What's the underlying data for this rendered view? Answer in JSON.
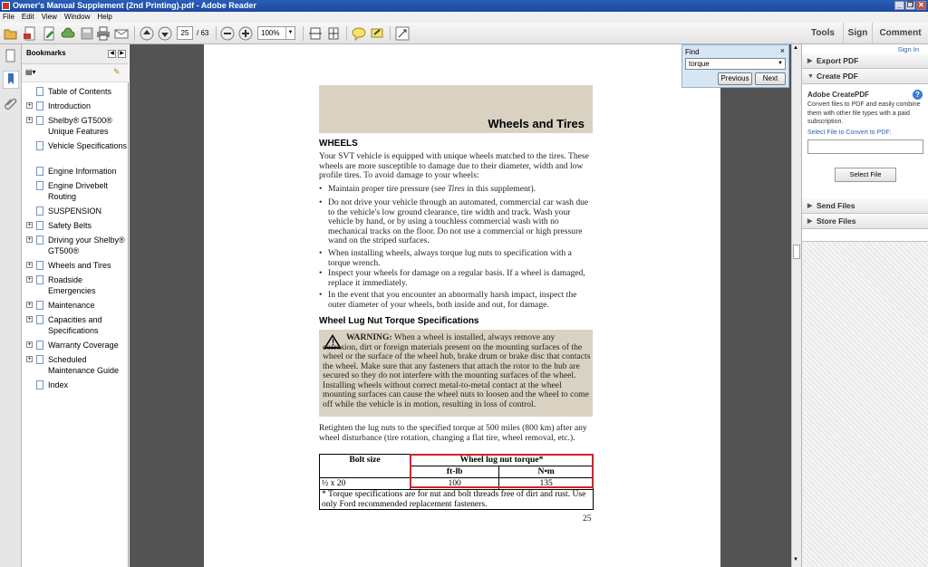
{
  "window": {
    "title": "Owner's Manual Supplement (2nd Printing).pdf - Adobe Reader"
  },
  "menu": [
    "File",
    "Edit",
    "View",
    "Window",
    "Help"
  ],
  "toolbar": {
    "page_current": "25",
    "page_total": "/ 63",
    "zoom": "100%",
    "tools": "Tools",
    "sign": "Sign",
    "comment": "Comment"
  },
  "bookmarks": {
    "title": "Bookmarks",
    "items": [
      {
        "label": "Table of Contents",
        "expandable": false
      },
      {
        "label": "Introduction",
        "expandable": true
      },
      {
        "label": "Shelby® GT500® Unique Features",
        "expandable": true
      },
      {
        "label": "Vehicle Specifications",
        "expandable": false
      },
      {
        "label": "Engine Information",
        "expandable": false
      },
      {
        "label": "Engine Drivebelt Routing",
        "expandable": false
      },
      {
        "label": "SUSPENSION",
        "expandable": false
      },
      {
        "label": "Safety Belts",
        "expandable": true
      },
      {
        "label": "Driving your Shelby® GT500®",
        "expandable": true
      },
      {
        "label": "Wheels and Tires",
        "expandable": true
      },
      {
        "label": "Roadside Emergencies",
        "expandable": true
      },
      {
        "label": "Maintenance",
        "expandable": true
      },
      {
        "label": "Capacities and Specifications",
        "expandable": true
      },
      {
        "label": "Warranty Coverage",
        "expandable": true
      },
      {
        "label": "Scheduled Maintenance Guide",
        "expandable": true
      },
      {
        "label": "Index",
        "expandable": false
      }
    ]
  },
  "document": {
    "header": "Wheels and Tires",
    "wheels_heading": "WHEELS",
    "intro": "Your SVT vehicle is equipped with unique wheels matched to the tires. These wheels are more susceptible to damage due to their diameter, width and low profile tires. To avoid damage to your wheels:",
    "bullets": [
      "Maintain proper tire pressure (see Tires in this supplement).",
      "Do not drive your vehicle through an automated, commercial car wash due to the vehicle's low ground clearance, tire width and track. Wash your vehicle by hand, or by using a touchless commercial wash with no mechanical tracks on the floor. Do not use a commercial or high pressure wand on the striped surfaces.",
      "When installing wheels, always torque lug nuts to specification with a torque wrench.",
      "Inspect your wheels for damage on a regular basis. If a wheel is damaged, replace it immediately.",
      "In the event that you encounter an abnormally harsh impact, inspect the outer diameter of your wheels, both inside and out, for damage."
    ],
    "lug_heading": "Wheel Lug Nut Torque Specifications",
    "warning_label": "WARNING:",
    "warning_text": "When a wheel is installed, always remove any corrosion, dirt or foreign materials present on the mounting surfaces of the wheel or the surface of the wheel hub, brake drum or brake disc that contacts the wheel. Make sure that any fasteners that attach the rotor to the hub are secured so they do not interfere with the mounting surfaces of the wheel. Installing wheels without correct metal-to-metal contact at the wheel mounting surfaces can cause the wheel nuts to loosen and the wheel to come off while the vehicle is in motion, resulting in loss of control.",
    "retighten": "Retighten the lug nuts to the specified torque at 500 miles (800 km) after any wheel disturbance (tire rotation, changing a flat tire, wheel removal, etc.).",
    "table": {
      "col_bolt": "Bolt size",
      "col_torque": "Wheel lug nut torque*",
      "col_ftlb": "ft-lb",
      "col_nm": "N•m",
      "row_bolt": "½ x 20",
      "row_ftlb": "100",
      "row_nm": "135",
      "footnote": "* Torque specifications are for nut and bolt threads free of dirt and rust. Use only Ford recommended replacement fasteners."
    },
    "page_number": "25"
  },
  "find": {
    "title": "Find",
    "query": "torque",
    "previous": "Previous",
    "next": "Next"
  },
  "rightpanel": {
    "signin": "Sign In",
    "export_pdf": "Export PDF",
    "create_pdf": "Create PDF",
    "createpdf_title": "Adobe CreatePDF",
    "createpdf_desc": "Convert files to PDF and easily combine them with other file types with a paid subscription.",
    "select_label": "Select File to Convert to PDF:",
    "select_button": "Select File",
    "send_files": "Send Files",
    "store_files": "Store Files"
  }
}
